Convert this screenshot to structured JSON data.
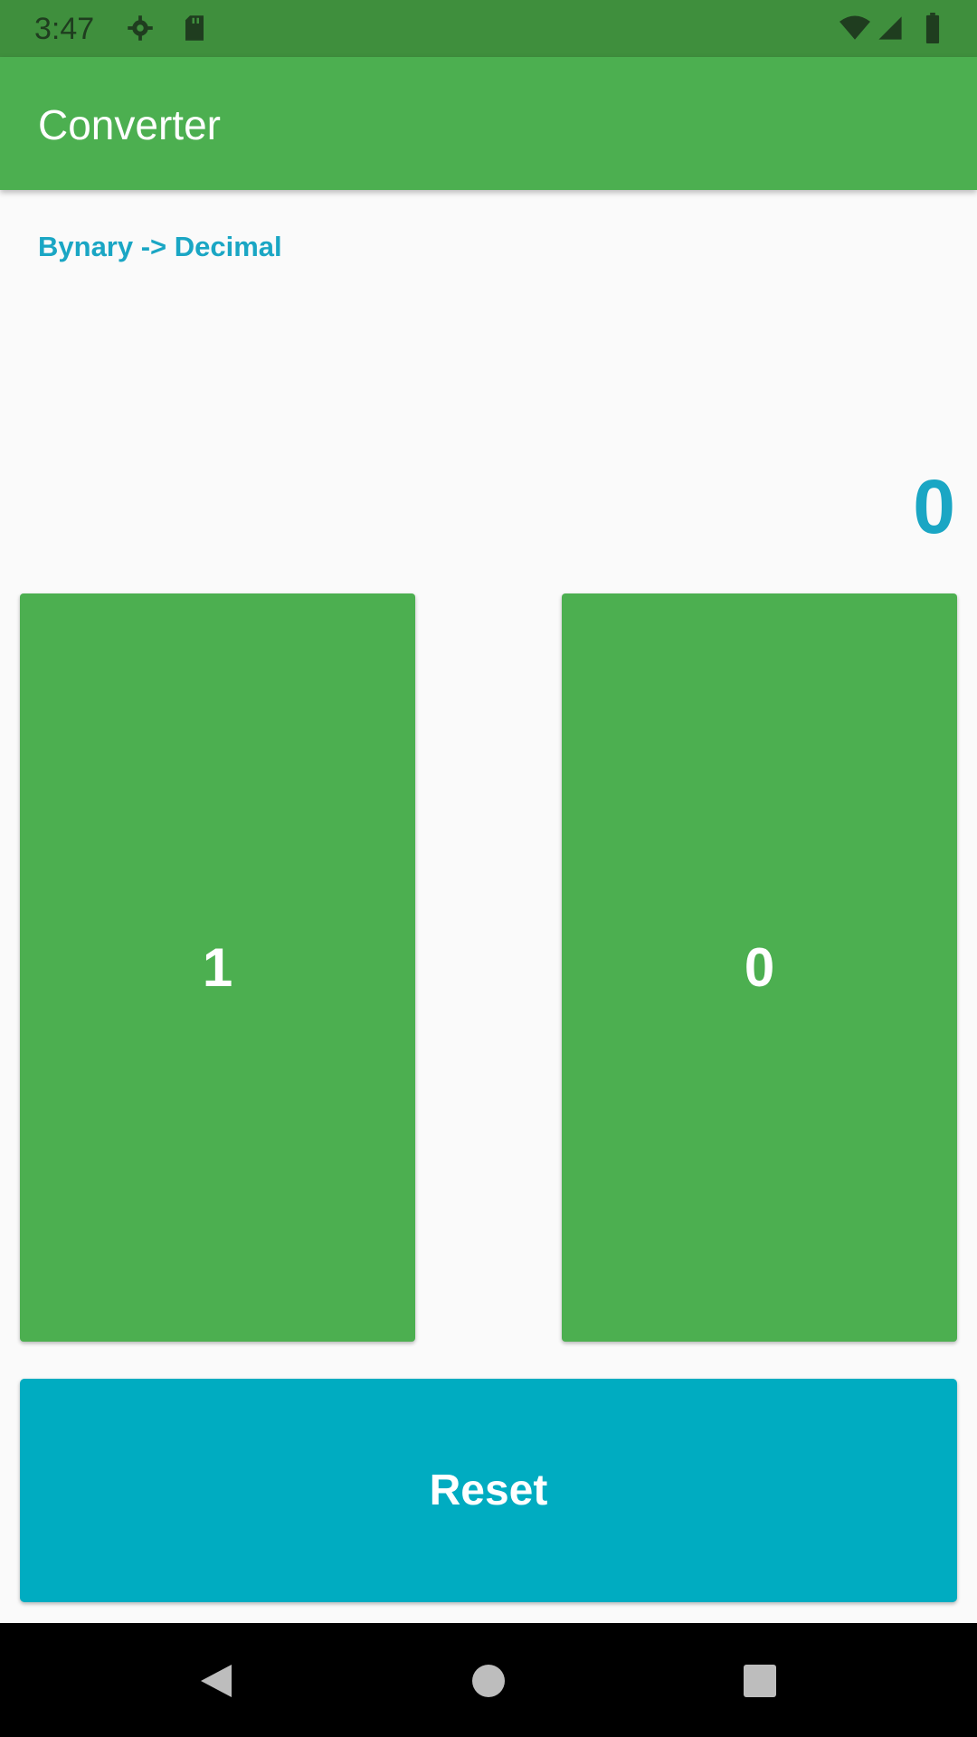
{
  "status_bar": {
    "time": "3:47",
    "icons": [
      "settings-gear-icon",
      "sd-card-icon",
      "wifi-icon",
      "signal-icon",
      "battery-icon"
    ]
  },
  "app_bar": {
    "title": "Converter"
  },
  "main": {
    "mode_label": "Bynary -> Decimal",
    "result": "0",
    "bit_buttons": [
      {
        "label": "1"
      },
      {
        "label": "0"
      }
    ],
    "reset_label": "Reset"
  },
  "nav_bar": {
    "icons": [
      "back-icon",
      "home-icon",
      "recents-icon"
    ]
  },
  "colors": {
    "primary": "#4caf50",
    "primary_dark": "#3f8f3d",
    "accent": "#00acc1",
    "accent_text": "#1aa6c4"
  }
}
